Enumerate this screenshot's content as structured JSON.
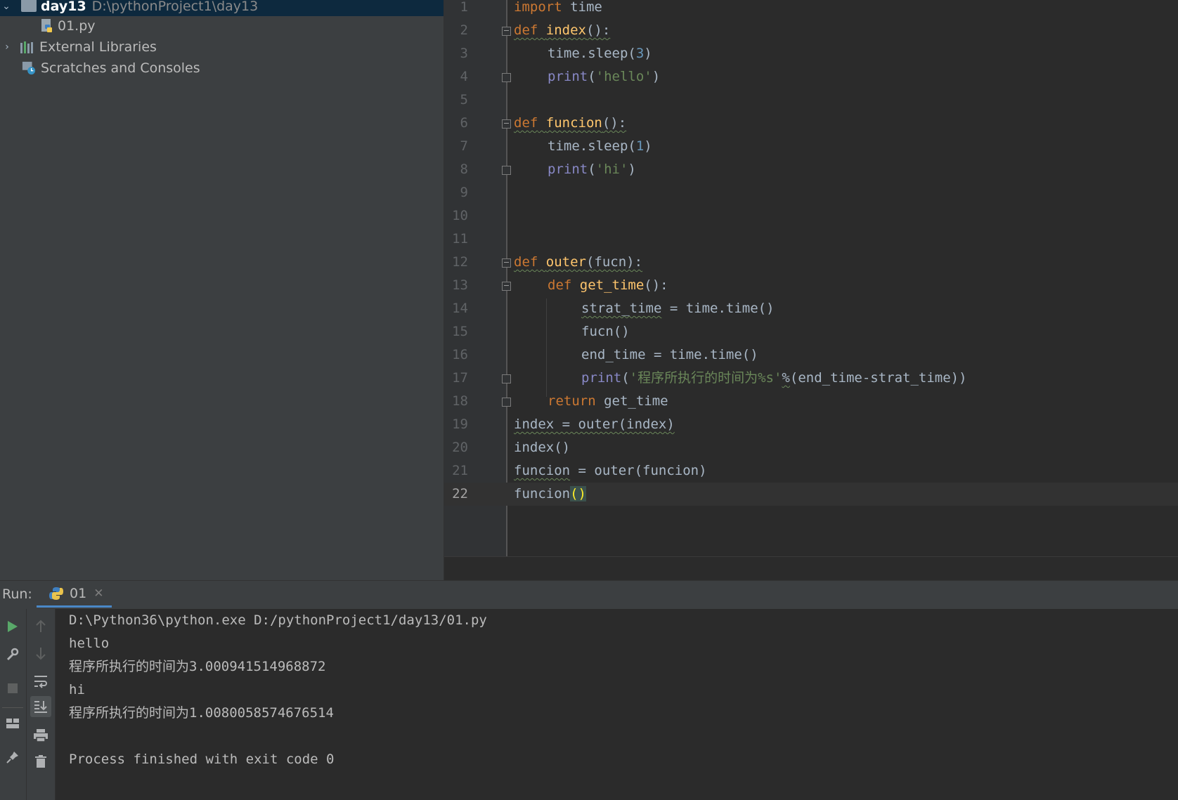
{
  "project_tree": {
    "items": [
      {
        "name": "day13",
        "path": "D:\\pythonProject1\\day13",
        "kind": "folder",
        "expanded": true
      },
      {
        "name": "01.py",
        "kind": "python-file-icon"
      },
      {
        "name": "External Libraries",
        "kind": "library-icon"
      },
      {
        "name": "Scratches and Consoles",
        "kind": "scratches-icon"
      }
    ]
  },
  "editor": {
    "line_numbers": [
      "1",
      "2",
      "3",
      "4",
      "5",
      "6",
      "7",
      "8",
      "9",
      "10",
      "11",
      "12",
      "13",
      "14",
      "15",
      "16",
      "17",
      "18",
      "19",
      "20",
      "21",
      "22"
    ],
    "code": {
      "l1_k": "import",
      "l1_t": " time",
      "l2_k": "def",
      "l2_f": "index",
      "l2_t": "():",
      "l3_a": "time.sleep(",
      "l3_n": "3",
      "l3_b": ")",
      "l4_b": "print",
      "l4_a": "(",
      "l4_s": "'hello'",
      "l4_c": ")",
      "l6_k": "def",
      "l6_f": "funcion",
      "l6_t": "():",
      "l7_a": "time.sleep(",
      "l7_n": "1",
      "l7_b": ")",
      "l8_b": "print",
      "l8_a": "(",
      "l8_s": "'hi'",
      "l8_c": ")",
      "l12_k": "def",
      "l12_f": "outer",
      "l12_t": "(fucn):",
      "l13_k": "def",
      "l13_f": "get_time",
      "l13_t": "():",
      "l14_v": "strat_time",
      "l14_t": " = time.time()",
      "l15_t": "fucn()",
      "l16_t": "end_time = time.time()",
      "l17_b": "print",
      "l17_a": "(",
      "l17_s": "'程序所执行的时间为%s'",
      "l17_p": "%",
      "l17_t": "(end_time-strat_time))",
      "l18_k": "return",
      "l18_t": " get_time",
      "l19_t": "index = outer(index)",
      "l20_t": "index()",
      "l21_v": "funcion",
      "l21_t": " = outer(funcion)",
      "l22_t": "funcion",
      "l22_br": "()"
    },
    "current_line": "22"
  },
  "run_panel": {
    "label": "Run:",
    "tab_label": "01",
    "console_lines": [
      "D:\\Python36\\python.exe D:/pythonProject1/day13/01.py",
      "hello",
      "程序所执行的时间为3.000941514968872",
      "hi",
      "程序所执行的时间为1.0080058574676514",
      "",
      "Process finished with exit code 0"
    ],
    "toolbar_icons": [
      "run-icon",
      "wrench-icon",
      "stop-icon",
      "layout-icon",
      "pin-icon",
      "up-arrow-icon",
      "down-arrow-icon",
      "soft-wrap-icon",
      "scroll-to-end-icon",
      "print-icon",
      "trash-icon"
    ]
  },
  "colors": {
    "keyword": "#cc7832",
    "function": "#ffc66d",
    "number": "#6897bb",
    "string": "#6a8759",
    "builtin": "#8888c6",
    "text": "#a9b7c6",
    "selection": "#0d293e",
    "run_green": "#59a869"
  }
}
